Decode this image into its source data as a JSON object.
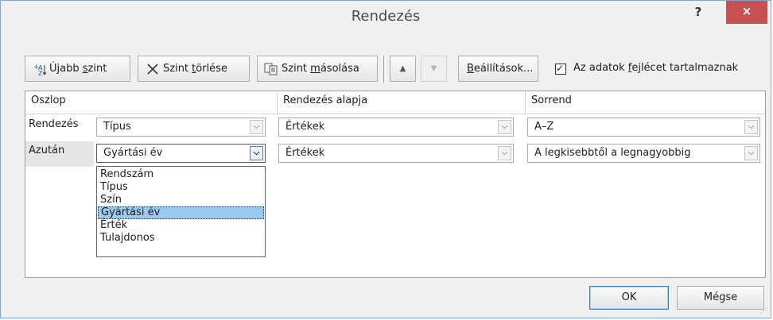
{
  "title": "Rendezés",
  "titlebar": {
    "help": "?",
    "close": "×"
  },
  "toolbar": {
    "add_level": {
      "pre": "Újabb ",
      "key": "s",
      "post": "zint"
    },
    "delete_level": {
      "pre": "Szint ",
      "key": "t",
      "post": "örlése"
    },
    "copy_level": {
      "pre": "Szint ",
      "key": "m",
      "post": "ásolása"
    },
    "move_up": "▲",
    "move_down": "▼",
    "options": {
      "pre": "",
      "key": "B",
      "post": "eállítások..."
    },
    "header_checkbox": {
      "checked": true,
      "mark": "✓",
      "pre": "Az adatok ",
      "key": "f",
      "post": "ejlécet tartalmaznak"
    }
  },
  "grid": {
    "headers": {
      "column": "Oszlop",
      "sort_on": "Rendezés alapja",
      "order": "Sorrend"
    },
    "rows": [
      {
        "label": "Rendezés",
        "column": "Típus",
        "sort_on": "Értékek",
        "order": "A–Z"
      },
      {
        "label": "Azután",
        "column": "Gyártási év",
        "sort_on": "Értékek",
        "order": "A legkisebbtől a legnagyobbig"
      }
    ]
  },
  "dropdown": {
    "options": [
      "Rendszám",
      "Típus",
      "Szín",
      "Gyártási év",
      "Érték",
      "Tulajdonos"
    ],
    "selected": "Gyártási év"
  },
  "footer": {
    "ok": "OK",
    "cancel": "Mégse"
  },
  "colors": {
    "close_button": "#c75050",
    "selection": "#99c9ef"
  }
}
